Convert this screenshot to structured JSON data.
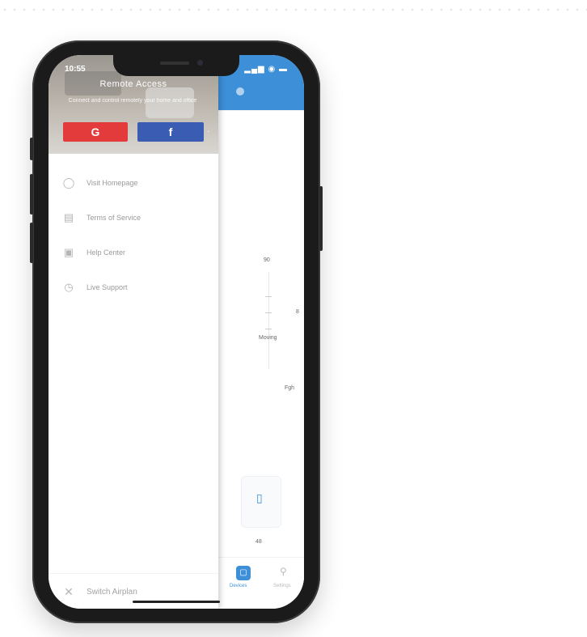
{
  "status_bar": {
    "time": "10:55",
    "icons": "▂▄▆ ◉ ▬"
  },
  "drawer": {
    "hero": {
      "title": "Remote Access",
      "subtitle": "Connect and control remotely your home and office"
    },
    "login": {
      "google_label": "G",
      "facebook_label": "f",
      "more_label": "·"
    },
    "menu_items": [
      {
        "label": "Visit Homepage",
        "icon": "globe-icon"
      },
      {
        "label": "Terms of Service",
        "icon": "document-icon"
      },
      {
        "label": "Help Center",
        "icon": "help-icon"
      },
      {
        "label": "Live Support",
        "icon": "chat-icon"
      }
    ],
    "bottom": {
      "label": "Switch Airplan",
      "icon": "switch-icon"
    }
  },
  "app": {
    "chart_labels": [
      "90",
      "8",
      "Moving",
      "Fgh"
    ],
    "device_caption": "48",
    "tabs": [
      {
        "label": "Devices",
        "active": true
      },
      {
        "label": "Settings",
        "active": false
      }
    ]
  },
  "colors": {
    "accent": "#3d8fd8",
    "google": "#e33b3b",
    "facebook": "#3b5cb3"
  }
}
